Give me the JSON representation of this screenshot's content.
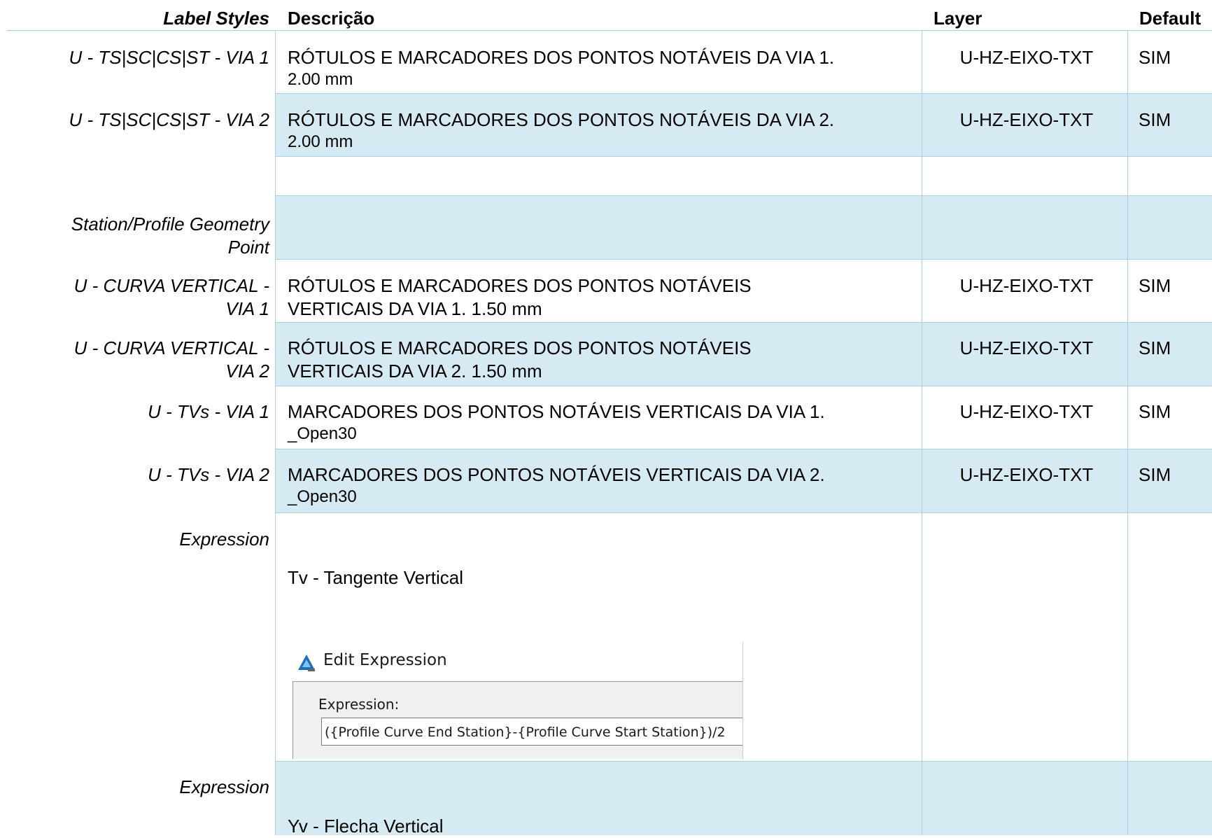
{
  "header": {
    "label_styles": "Label Styles",
    "descricao": "Descrição",
    "layer": "Layer",
    "default": "Default"
  },
  "rows": [
    {
      "label": "U - TS|SC|CS|ST - VIA 1",
      "desc": "RÓTULOS E MARCADORES DOS PONTOS NOTÁVEIS DA VIA 1.",
      "desc2": "2.00 mm",
      "layer": "U-HZ-EIXO-TXT",
      "default": "SIM"
    },
    {
      "label": "U - TS|SC|CS|ST - VIA 2",
      "desc": "RÓTULOS E MARCADORES DOS PONTOS NOTÁVEIS DA VIA 2.",
      "desc2": "2.00 mm",
      "layer": "U-HZ-EIXO-TXT",
      "default": "SIM"
    },
    {
      "label": "",
      "desc": "",
      "desc2": "",
      "layer": "",
      "default": ""
    },
    {
      "label": "Station/Profile Geometry",
      "label2": "Point",
      "desc": "",
      "desc2": "",
      "layer": "",
      "default": ""
    },
    {
      "label": "U - CURVA VERTICAL -",
      "label2": "VIA 1",
      "desc": "RÓTULOS E MARCADORES DOS PONTOS NOTÁVEIS",
      "desc2": "VERTICAIS DA VIA 1. 1.50 mm",
      "layer": "U-HZ-EIXO-TXT",
      "default": "SIM"
    },
    {
      "label": "U - CURVA VERTICAL -",
      "label2": "VIA 2",
      "desc": "RÓTULOS E MARCADORES DOS PONTOS NOTÁVEIS",
      "desc2": "VERTICAIS DA VIA 2. 1.50 mm",
      "layer": "U-HZ-EIXO-TXT",
      "default": "SIM"
    },
    {
      "label": "U - TVs - VIA 1",
      "desc": "MARCADORES DOS PONTOS NOTÁVEIS VERTICAIS DA VIA 1.",
      "desc2": "_Open30",
      "layer": "U-HZ-EIXO-TXT",
      "default": "SIM"
    },
    {
      "label": "U - TVs - VIA 2",
      "desc": "MARCADORES DOS PONTOS NOTÁVEIS VERTICAIS DA VIA 2.",
      "desc2": "_Open30",
      "layer": "U-HZ-EIXO-TXT",
      "default": "SIM"
    }
  ],
  "expression_rows": [
    {
      "label": "Expression",
      "text": "Tv - Tangente Vertical",
      "dialog": {
        "title": "Edit Expression",
        "field_label": "Expression:",
        "field_value": "({Profile Curve End Station}-{Profile Curve Start Station})/2",
        "icon": "autocad-icon"
      }
    },
    {
      "label": "Expression",
      "text": "Yv - Flecha Vertical"
    }
  ],
  "colors": {
    "row_shade": "#d5eaf3",
    "grid_line": "#a9d2e3"
  }
}
